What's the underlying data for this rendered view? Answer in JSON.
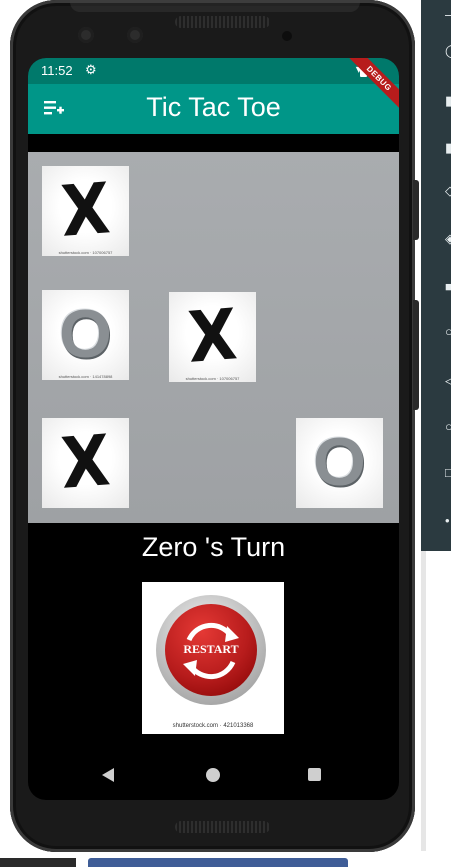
{
  "status_bar": {
    "time": "11:52"
  },
  "app_bar": {
    "title": "Tic Tac Toe",
    "debug_badge": "DEBUG"
  },
  "board": {
    "cells": [
      {
        "mark": "X",
        "credit": "shutterstock.com · 107006757"
      },
      {
        "mark": "",
        "credit": ""
      },
      {
        "mark": "",
        "credit": ""
      },
      {
        "mark": "O",
        "credit": "shutterstock.com · 141478898"
      },
      {
        "mark": "X",
        "credit": "shutterstock.com · 107006757"
      },
      {
        "mark": "",
        "credit": ""
      },
      {
        "mark": "X",
        "credit": ""
      },
      {
        "mark": "",
        "credit": ""
      },
      {
        "mark": "O",
        "credit": ""
      }
    ]
  },
  "turn_text": "Zero 's Turn",
  "restart": {
    "label": "RESTART",
    "credit": "shutterstock.com · 421013368"
  },
  "colors": {
    "status_bar": "#00796b",
    "app_bar": "#009688",
    "board_bg": "#a9acaf",
    "restart_red": "#b71c1c"
  },
  "icons": {
    "menu": "playlist-add-icon",
    "settings": "gear-icon",
    "back": "nav-back-icon",
    "home": "nav-home-icon",
    "recents": "nav-recents-icon"
  }
}
